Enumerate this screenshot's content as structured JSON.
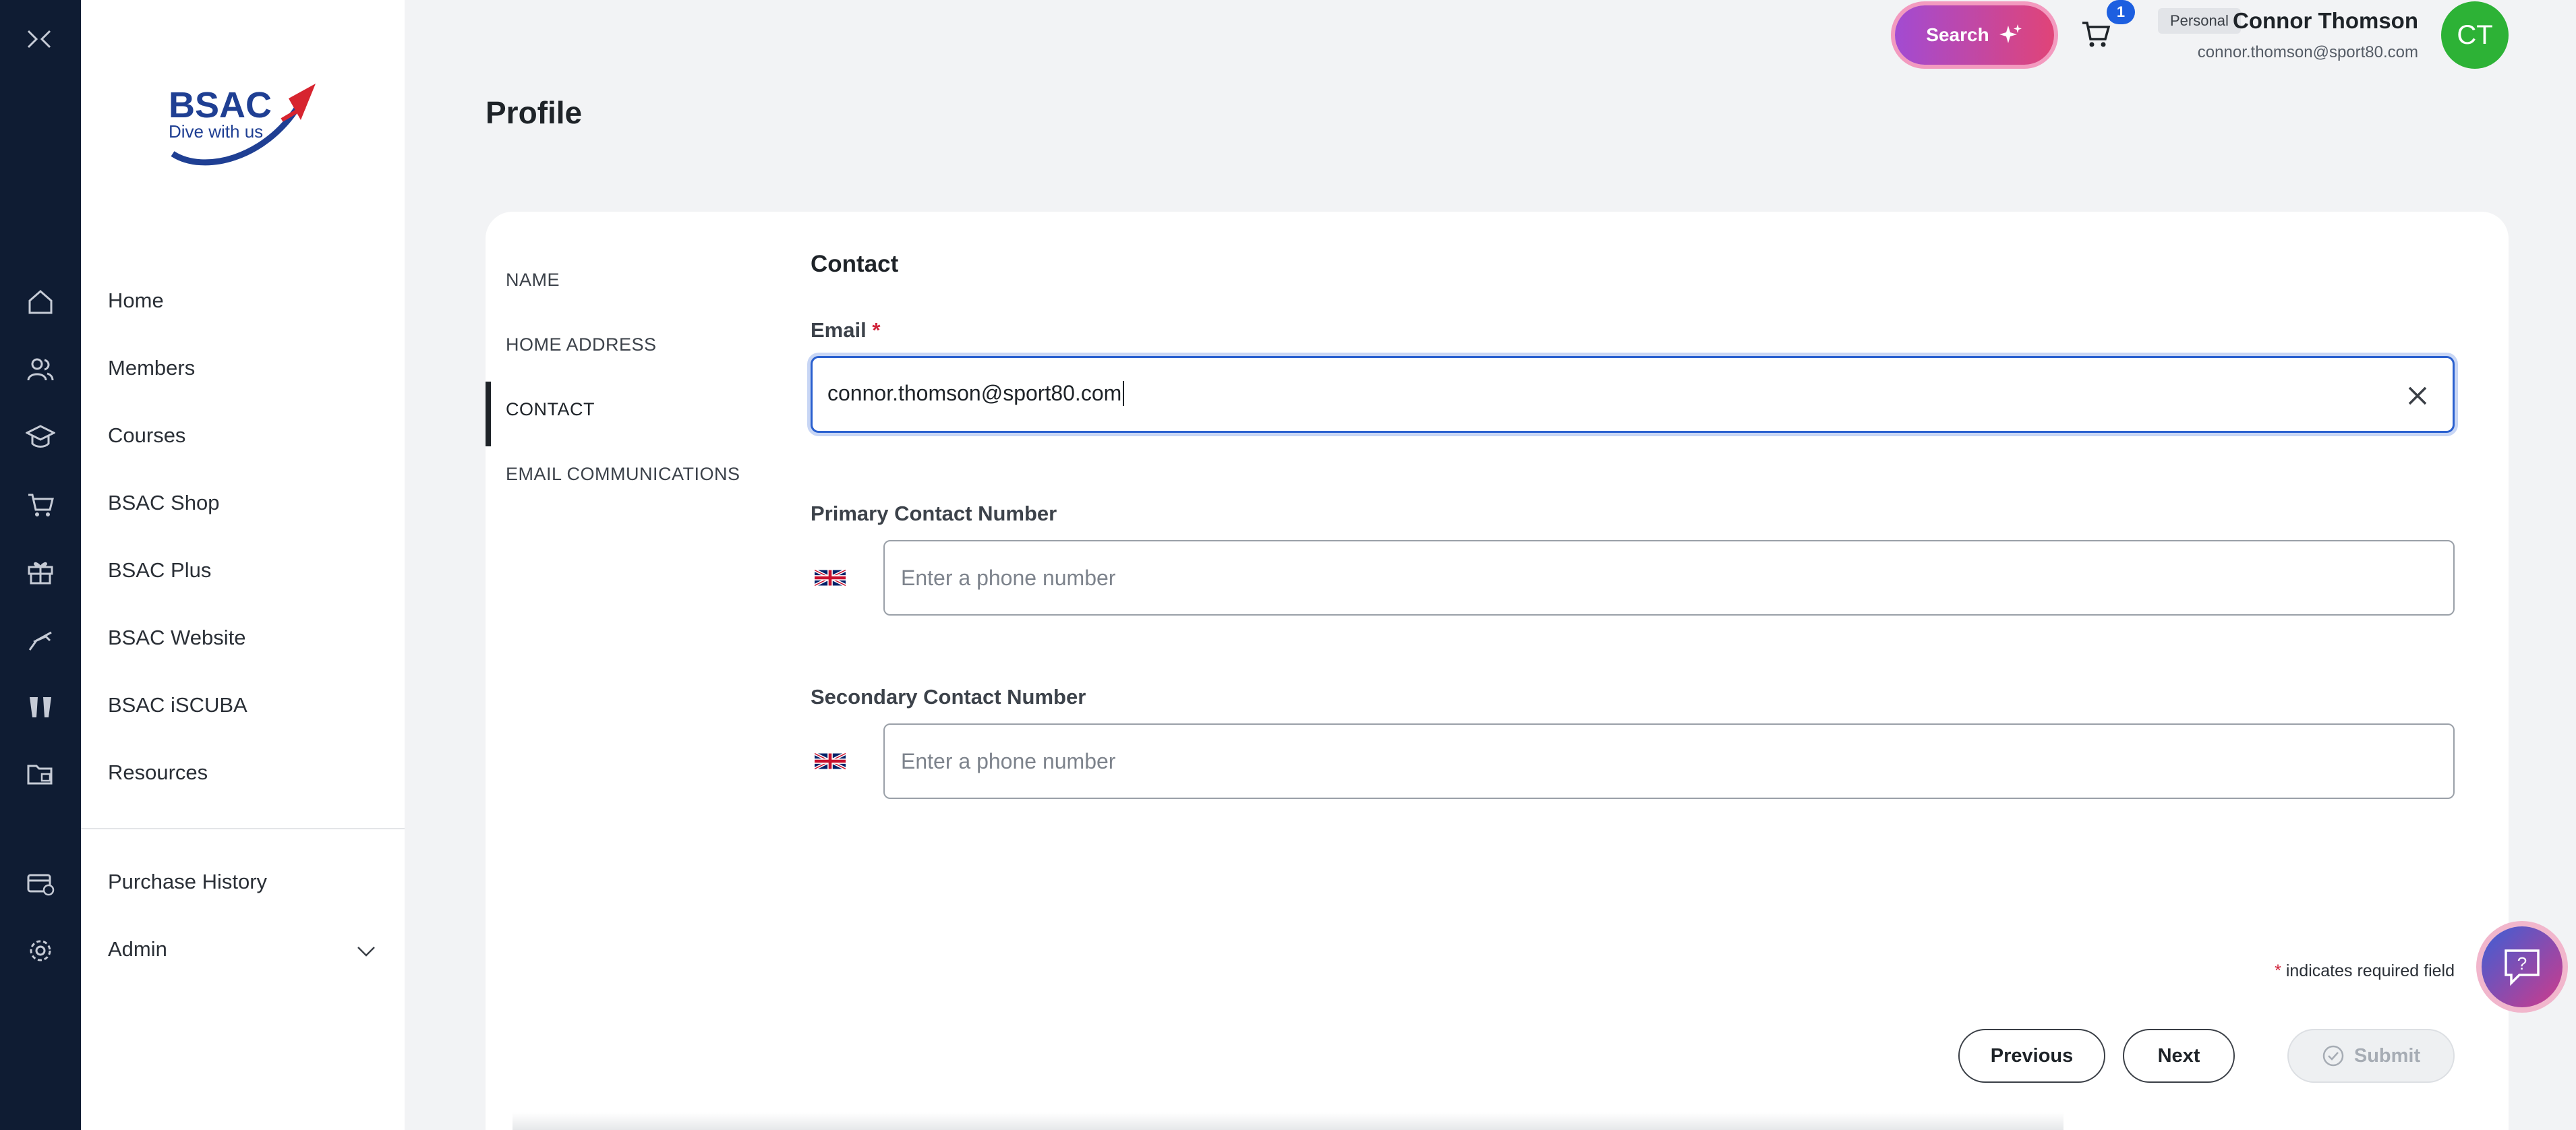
{
  "nav": {
    "items": [
      {
        "label": "Home",
        "icon": "home-icon"
      },
      {
        "label": "Members",
        "icon": "members-icon"
      },
      {
        "label": "Courses",
        "icon": "courses-icon"
      },
      {
        "label": "BSAC Shop",
        "icon": "shop-cart-icon"
      },
      {
        "label": "BSAC Plus",
        "icon": "gift-icon"
      },
      {
        "label": "BSAC Website",
        "icon": "dive-flag-icon"
      },
      {
        "label": "BSAC iSCUBA",
        "icon": "fins-icon"
      },
      {
        "label": "Resources",
        "icon": "folder-icon"
      }
    ],
    "footer_items": [
      {
        "label": "Purchase History",
        "icon": "purchase-history-icon"
      },
      {
        "label": "Admin",
        "icon": "gear-icon"
      }
    ]
  },
  "logo": {
    "line1": "BSAC",
    "line2": "Dive with us"
  },
  "topbar": {
    "search_label": "Search",
    "cart_count": "1",
    "account_type": "Personal",
    "user_name": "Connor Thomson",
    "user_email": "connor.thomson@sport80.com",
    "avatar_initials": "CT"
  },
  "page": {
    "title": "Profile"
  },
  "steps": [
    {
      "label": "NAME"
    },
    {
      "label": "HOME ADDRESS"
    },
    {
      "label": "CONTACT"
    },
    {
      "label": "EMAIL COMMUNICATIONS"
    }
  ],
  "form": {
    "section_title": "Contact",
    "email_label": "Email",
    "required_marker": "*",
    "email_value": "connor.thomson@sport80.com",
    "primary_label": "Primary Contact Number",
    "primary_placeholder": "Enter a phone number",
    "secondary_label": "Secondary Contact Number",
    "secondary_placeholder": "Enter a phone number",
    "required_note": "indicates required field"
  },
  "buttons": {
    "previous": "Previous",
    "next": "Next",
    "submit": "Submit"
  },
  "colors": {
    "rail": "#0f1c33",
    "accent_blue": "#2a60cf",
    "avatar": "#2db236",
    "required": "#d0233a"
  }
}
